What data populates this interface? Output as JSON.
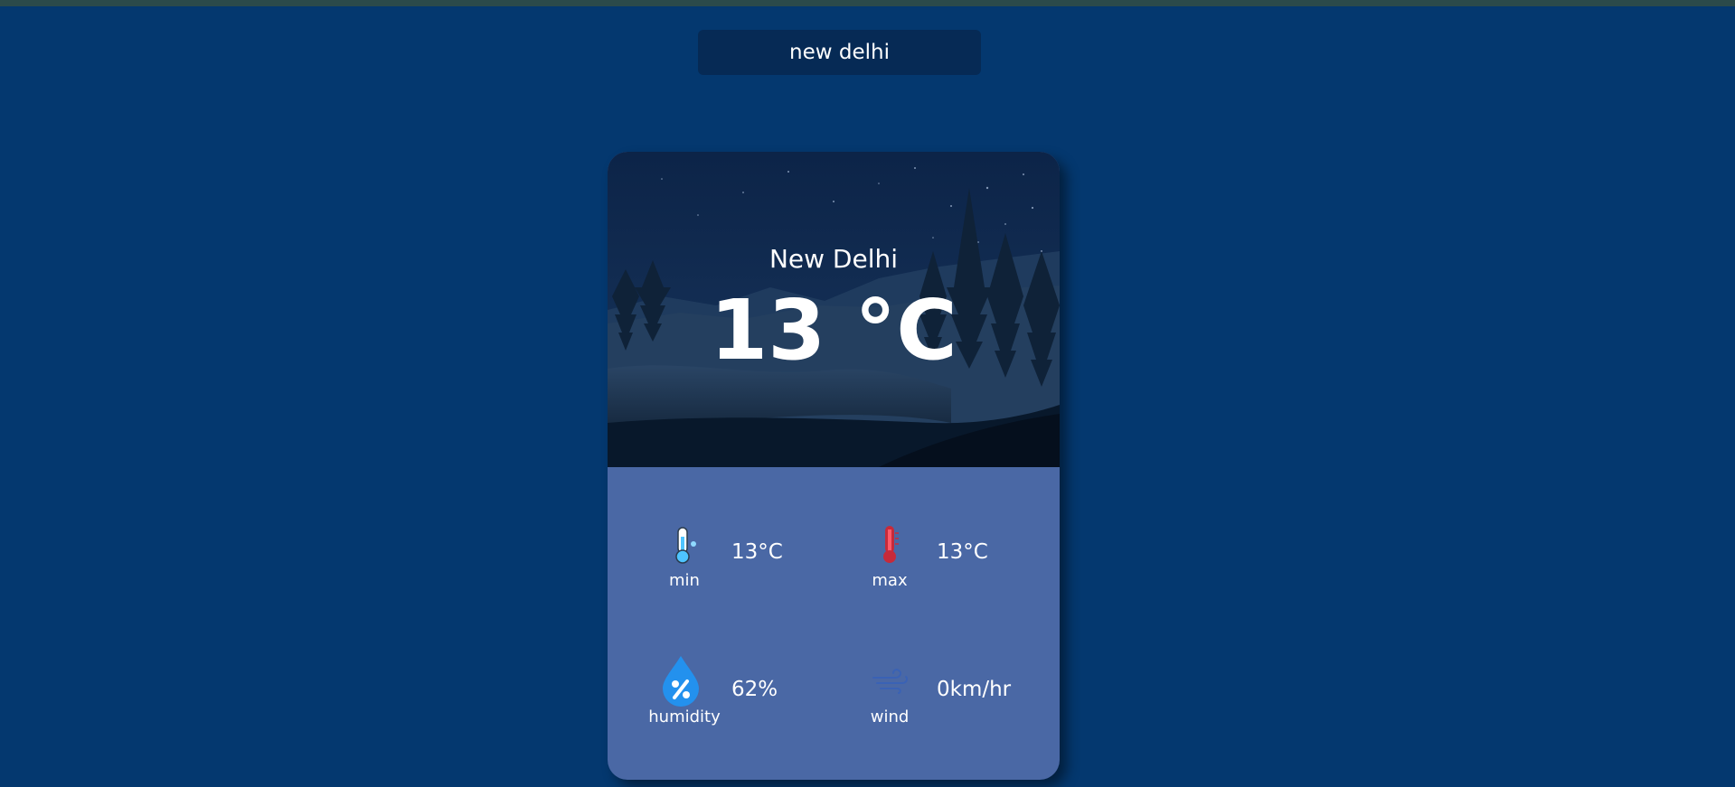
{
  "search": {
    "value": "new delhi"
  },
  "weather": {
    "city": "New Delhi",
    "temperature": "13 °C"
  },
  "stats": {
    "min": {
      "label": "min",
      "value": "13°C",
      "icon": "thermometer-cold-icon"
    },
    "max": {
      "label": "max",
      "value": "13°C",
      "icon": "thermometer-hot-icon"
    },
    "humidity": {
      "label": "humidity",
      "value": "62%",
      "icon": "humidity-drop-icon"
    },
    "wind": {
      "label": "wind",
      "value": "0km/hr",
      "icon": "wind-icon"
    }
  },
  "colors": {
    "page_background": "#04386f",
    "card_bottom": "#4a68a5",
    "search_background": "#062a55",
    "text": "#ffffff"
  }
}
